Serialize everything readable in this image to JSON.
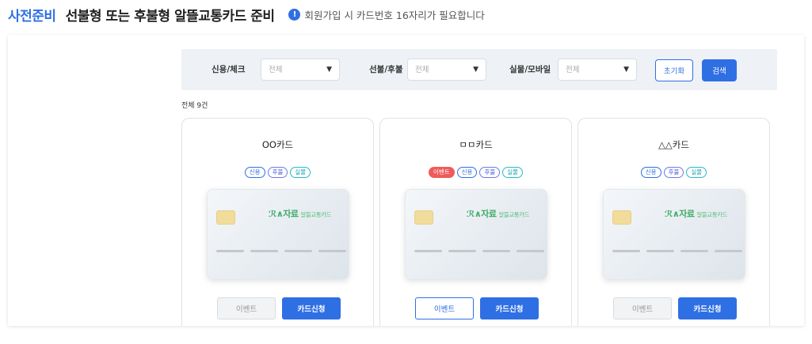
{
  "header": {
    "step": "사전준비",
    "title": "선불형 또는 후불형 알뜰교통카드 준비",
    "notice_icon": "!",
    "notice": "회원가입 시 카드번호 16자리가 필요합니다"
  },
  "filters": {
    "credit_check": {
      "label": "신용/체크",
      "value": "전체",
      "arrow": "▼"
    },
    "prepaid_postpaid": {
      "label": "선불/후불",
      "value": "전체",
      "arrow": "▼"
    },
    "physical_mobile": {
      "label": "실물/모바일",
      "value": "전체",
      "arrow": "▼"
    },
    "reset_label": "초기화",
    "search_label": "검색"
  },
  "total_count": "전체 9건",
  "cards": [
    {
      "name": "OO카드",
      "event_tag": "",
      "tags": [
        "신용",
        "후불",
        "실물"
      ],
      "logo": "ℛ∧자료",
      "logo_sub": "알뜰교통카드",
      "event_button": "이벤트",
      "event_enabled": false,
      "apply_button": "카드신청"
    },
    {
      "name": "ㅁㅁ카드",
      "event_tag": "이벤트",
      "tags": [
        "신용",
        "후불",
        "실물"
      ],
      "logo": "ℛ∧자료",
      "logo_sub": "알뜰교통카드",
      "event_button": "이벤트",
      "event_enabled": true,
      "apply_button": "카드신청"
    },
    {
      "name": "△△카드",
      "event_tag": "",
      "tags": [
        "신용",
        "후불",
        "실물"
      ],
      "logo": "ℛ∧자료",
      "logo_sub": "알뜰교통카드",
      "event_button": "이벤트",
      "event_enabled": false,
      "apply_button": "카드신청"
    }
  ],
  "colors": {
    "accent": "#2f6fe4",
    "event_tag": "#f05a5a",
    "logo_green": "#3fab6a",
    "filter_bg": "#eef1f5"
  }
}
